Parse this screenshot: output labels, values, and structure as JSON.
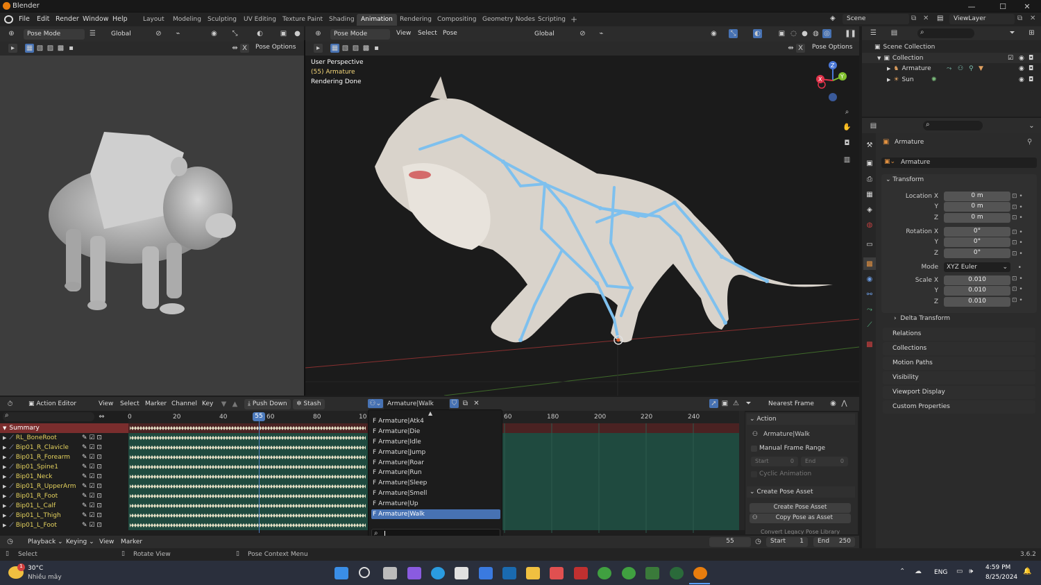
{
  "window": {
    "title": "Blender",
    "minimize": "—",
    "maximize": "☐",
    "close": "✕"
  },
  "menu": [
    "File",
    "Edit",
    "Render",
    "Window",
    "Help"
  ],
  "workspaces": [
    "Layout",
    "Modeling",
    "Sculpting",
    "UV Editing",
    "Texture Paint",
    "Shading",
    "Animation",
    "Rendering",
    "Compositing",
    "Geometry Nodes",
    "Scripting"
  ],
  "active_workspace": "Animation",
  "scene": "Scene",
  "view_layer": "ViewLayer",
  "left_viewport": {
    "mode": "Pose Mode",
    "orientation": "Global",
    "pose_options": "Pose Options"
  },
  "main_viewport": {
    "mode": "Pose Mode",
    "menus": [
      "View",
      "Select",
      "Pose"
    ],
    "orientation": "Global",
    "pose_options": "Pose Options",
    "overlay_lines": [
      "User Perspective",
      "(55) Armature",
      "Rendering Done"
    ],
    "gizmo": {
      "z": "Z",
      "y": "Y",
      "x": "X"
    }
  },
  "outliner": {
    "search_placeholder": "",
    "rows": [
      {
        "label": "Scene Collection"
      },
      {
        "label": "Collection"
      },
      {
        "label": "Armature"
      },
      {
        "label": "Sun"
      }
    ]
  },
  "properties": {
    "object_name": "Armature",
    "data_name": "Armature",
    "transform_title": "Transform",
    "location": {
      "label": "Location X",
      "x": "0 m",
      "y": "0 m",
      "z": "0 m"
    },
    "rotation": {
      "label": "Rotation X",
      "x": "0°",
      "y": "0°",
      "z": "0°"
    },
    "mode_label": "Mode",
    "mode_value": "XYZ Euler",
    "scale": {
      "label": "Scale X",
      "x": "0.010",
      "y": "0.010",
      "z": "0.010"
    },
    "axis_y": "Y",
    "axis_z": "Z",
    "delta": "Delta Transform",
    "panels": [
      "Relations",
      "Collections",
      "Motion Paths",
      "Visibility",
      "Viewport Display",
      "Custom Properties"
    ]
  },
  "action_editor": {
    "editor_type": "Action Editor",
    "menus": [
      "View",
      "Select",
      "Marker",
      "Channel",
      "Key"
    ],
    "push_down": "Push Down",
    "stash": "Stash",
    "action_name": "Armature|Walk",
    "snap": "Nearest Frame",
    "current_frame": "55",
    "frame_labels_left": [
      "0",
      "20",
      "40",
      "60",
      "80",
      "10"
    ],
    "frame_labels_right": [
      "60",
      "180",
      "200",
      "220",
      "240"
    ],
    "summary": "Summary",
    "channels": [
      "RL_BoneRoot",
      "Bip01_R_Clavicle",
      "Bip01_R_Forearm",
      "Bip01_Spine1",
      "Bip01_Neck",
      "Bip01_R_UpperArm",
      "Bip01_R_Foot",
      "Bip01_L_Calf",
      "Bip01_L_Thigh",
      "Bip01_L_Foot"
    ]
  },
  "action_dropdown": {
    "items": [
      "Armature|Atk4",
      "Armature|Die",
      "Armature|Idle",
      "Armature|Jump",
      "Armature|Roar",
      "Armature|Run",
      "Armature|Sleep",
      "Armature|Smell",
      "Armature|Up",
      "Armature|Walk"
    ],
    "prefix": "F",
    "selected": "Armature|Walk",
    "search_value": ""
  },
  "side_panel": {
    "action_title": "Action",
    "action_value": "Armature|Walk",
    "manual_range": "Manual Frame Range",
    "start_label": "Start",
    "start_value": "0",
    "end_label": "End",
    "end_value": "0",
    "cyclic": "Cyclic Animation",
    "pose_asset_title": "Create Pose Asset",
    "create_btn": "Create Pose Asset",
    "copy_btn": "Copy Pose as Asset",
    "legacy": "Convert Legacy Pose Library"
  },
  "timeline": {
    "playback": "Playback",
    "keying": "Keying",
    "view": "View",
    "marker": "Marker",
    "frame": "55",
    "start_label": "Start",
    "start": "1",
    "end_label": "End",
    "end": "250"
  },
  "status": {
    "select": "Select",
    "rotate": "Rotate View",
    "context": "Pose Context Menu",
    "version": "3.6.2"
  },
  "taskbar": {
    "weather_temp": "30°C",
    "weather_desc": "Nhiều mây",
    "lang": "ENG",
    "time": "4:59 PM",
    "date": "8/25/2024",
    "badge": "1"
  },
  "colors": {
    "accent": "#4772b3",
    "bone": "#7ec0ee",
    "key_diamond": "#e8e2c8",
    "active_frame": "#4d7bbd",
    "channel_text": "#e6d35e"
  }
}
